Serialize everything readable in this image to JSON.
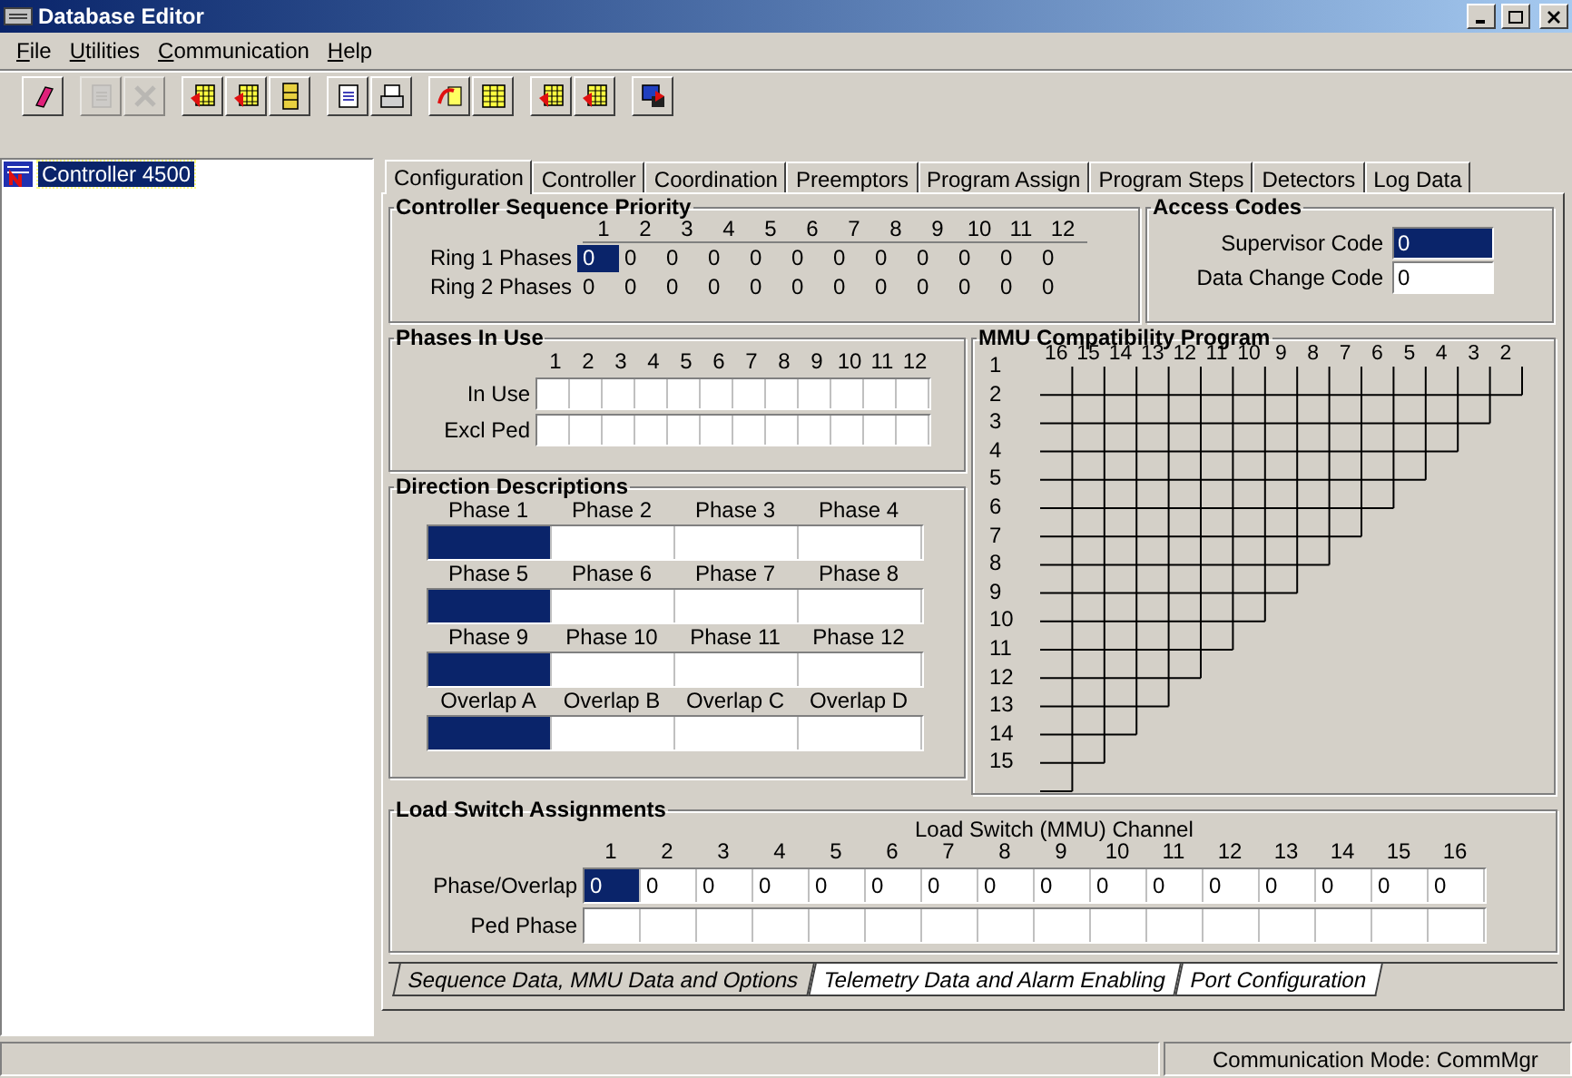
{
  "window": {
    "title": "Database Editor"
  },
  "menu": [
    "File",
    "Utilities",
    "Communication",
    "Help"
  ],
  "toolbar": [
    [
      {
        "disabled": false
      }
    ],
    [
      {
        "disabled": true
      },
      {
        "disabled": true
      }
    ],
    [
      {
        "disabled": false
      },
      {
        "disabled": false
      },
      {
        "disabled": false
      }
    ],
    [
      {
        "disabled": false
      },
      {
        "disabled": false
      }
    ],
    [
      {
        "disabled": false
      },
      {
        "disabled": false
      }
    ],
    [
      {
        "disabled": false
      },
      {
        "disabled": false
      }
    ],
    [
      {
        "disabled": false
      }
    ]
  ],
  "tree": [
    {
      "label": "Controller 4500",
      "selected": true
    }
  ],
  "tabs": [
    {
      "label": "Configuration",
      "selected": true
    },
    {
      "label": "Controller",
      "selected": false
    },
    {
      "label": "Coordination",
      "selected": false
    },
    {
      "label": "Preemptors",
      "selected": false
    },
    {
      "label": "Program Assign",
      "selected": false
    },
    {
      "label": "Program Steps",
      "selected": false
    },
    {
      "label": "Detectors",
      "selected": false
    },
    {
      "label": "Log Data",
      "selected": false
    }
  ],
  "sequence_priority": {
    "title": "Controller Sequence Priority",
    "columns": [
      "1",
      "2",
      "3",
      "4",
      "5",
      "6",
      "7",
      "8",
      "9",
      "10",
      "11",
      "12"
    ],
    "rows": [
      {
        "label": "Ring 1 Phases",
        "cells": [
          {
            "value": "0",
            "selected": true
          },
          {
            "value": "0",
            "selected": false
          },
          {
            "value": "0",
            "selected": false
          },
          {
            "value": "0",
            "selected": false
          },
          {
            "value": "0",
            "selected": false
          },
          {
            "value": "0",
            "selected": false
          },
          {
            "value": "0",
            "selected": false
          },
          {
            "value": "0",
            "selected": false
          },
          {
            "value": "0",
            "selected": false
          },
          {
            "value": "0",
            "selected": false
          },
          {
            "value": "0",
            "selected": false
          },
          {
            "value": "0",
            "selected": false
          }
        ]
      },
      {
        "label": "Ring 2 Phases",
        "cells": [
          {
            "value": "0",
            "selected": false
          },
          {
            "value": "0",
            "selected": false
          },
          {
            "value": "0",
            "selected": false
          },
          {
            "value": "0",
            "selected": false
          },
          {
            "value": "0",
            "selected": false
          },
          {
            "value": "0",
            "selected": false
          },
          {
            "value": "0",
            "selected": false
          },
          {
            "value": "0",
            "selected": false
          },
          {
            "value": "0",
            "selected": false
          },
          {
            "value": "0",
            "selected": false
          },
          {
            "value": "0",
            "selected": false
          },
          {
            "value": "0",
            "selected": false
          }
        ]
      }
    ]
  },
  "access_codes": {
    "title": "Access Codes",
    "fields": [
      {
        "label": "Supervisor Code",
        "value": "0",
        "selected": true
      },
      {
        "label": "Data Change Code",
        "value": "0",
        "selected": false
      }
    ]
  },
  "phases_in_use": {
    "title": "Phases In Use",
    "columns": [
      "1",
      "2",
      "3",
      "4",
      "5",
      "6",
      "7",
      "8",
      "9",
      "10",
      "11",
      "12"
    ],
    "rows": [
      {
        "label": "In Use"
      },
      {
        "label": "Excl Ped"
      }
    ]
  },
  "direction_descriptions": {
    "title": "Direction Descriptions",
    "groups": [
      [
        {
          "label": "Phase 1",
          "selected": true
        },
        {
          "label": "Phase 2",
          "selected": false
        },
        {
          "label": "Phase 3",
          "selected": false
        },
        {
          "label": "Phase 4",
          "selected": false
        }
      ],
      [
        {
          "label": "Phase 5",
          "selected": true
        },
        {
          "label": "Phase 6",
          "selected": false
        },
        {
          "label": "Phase 7",
          "selected": false
        },
        {
          "label": "Phase 8",
          "selected": false
        }
      ],
      [
        {
          "label": "Phase 9",
          "selected": true
        },
        {
          "label": "Phase 10",
          "selected": false
        },
        {
          "label": "Phase 11",
          "selected": false
        },
        {
          "label": "Phase 12",
          "selected": false
        }
      ],
      [
        {
          "label": "Overlap A",
          "selected": true
        },
        {
          "label": "Overlap B",
          "selected": false
        },
        {
          "label": "Overlap C",
          "selected": false
        },
        {
          "label": "Overlap D",
          "selected": false
        }
      ]
    ]
  },
  "mmu": {
    "title": "MMU Compatibility Program",
    "columns": [
      "16",
      "15",
      "14",
      "13",
      "12",
      "11",
      "10",
      "9",
      "8",
      "7",
      "6",
      "5",
      "4",
      "3",
      "2"
    ],
    "rows": [
      "1",
      "2",
      "3",
      "4",
      "5",
      "6",
      "7",
      "8",
      "9",
      "10",
      "11",
      "12",
      "13",
      "14",
      "15"
    ]
  },
  "load_switch": {
    "title": "Load Switch Assignments",
    "caption": "Load Switch (MMU) Channel",
    "columns": [
      "1",
      "2",
      "3",
      "4",
      "5",
      "6",
      "7",
      "8",
      "9",
      "10",
      "11",
      "12",
      "13",
      "14",
      "15",
      "16"
    ],
    "rows": [
      {
        "label": "Phase/Overlap",
        "cells": [
          {
            "value": "0",
            "selected": true
          },
          {
            "value": "0",
            "selected": false
          },
          {
            "value": "0",
            "selected": false
          },
          {
            "value": "0",
            "selected": false
          },
          {
            "value": "0",
            "selected": false
          },
          {
            "value": "0",
            "selected": false
          },
          {
            "value": "0",
            "selected": false
          },
          {
            "value": "0",
            "selected": false
          },
          {
            "value": "0",
            "selected": false
          },
          {
            "value": "0",
            "selected": false
          },
          {
            "value": "0",
            "selected": false
          },
          {
            "value": "0",
            "selected": false
          },
          {
            "value": "0",
            "selected": false
          },
          {
            "value": "0",
            "selected": false
          },
          {
            "value": "0",
            "selected": false
          },
          {
            "value": "0",
            "selected": false
          }
        ]
      },
      {
        "label": "Ped Phase",
        "cells": [
          {
            "selected": false
          },
          {
            "selected": false
          },
          {
            "selected": false
          },
          {
            "selected": false
          },
          {
            "selected": false
          },
          {
            "selected": false
          },
          {
            "selected": false
          },
          {
            "selected": false
          },
          {
            "selected": false
          },
          {
            "selected": false
          },
          {
            "selected": false
          },
          {
            "selected": false
          },
          {
            "selected": false
          },
          {
            "selected": false
          },
          {
            "selected": false
          },
          {
            "selected": false
          }
        ]
      }
    ]
  },
  "bottom_tabs": [
    {
      "label": "Sequence Data, MMU Data and Options",
      "selected": true
    },
    {
      "label": "Telemetry Data and Alarm Enabling",
      "selected": false
    },
    {
      "label": "Port Configuration",
      "selected": false
    }
  ],
  "status_bar": {
    "mode": "Communication Mode: CommMgr"
  }
}
